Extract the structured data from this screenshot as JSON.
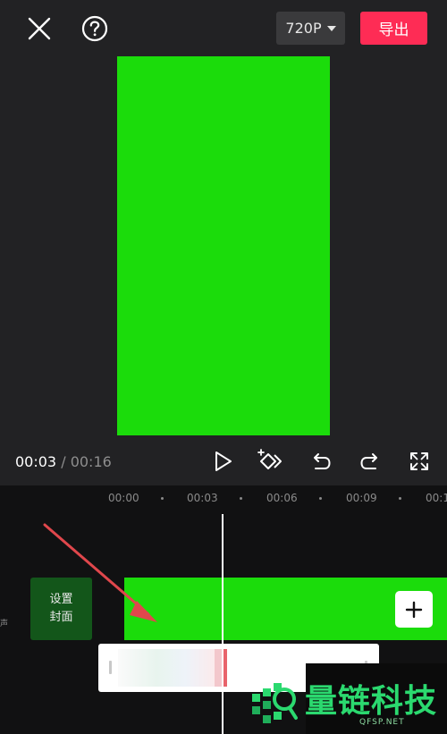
{
  "toolbar": {
    "resolution": "720P",
    "export_label": "导出"
  },
  "player": {
    "current_time": "00:03",
    "separator": "/",
    "total_time": "00:16"
  },
  "timeline": {
    "ruler": [
      "00:00",
      "00:03",
      "00:06",
      "00:09",
      "00:1"
    ],
    "side_label": "声",
    "cover_line1": "设置",
    "cover_line2": "封面"
  },
  "watermark": {
    "brand": "量链科技",
    "domain": "QFSP.NET"
  },
  "colors": {
    "accent": "#fe2c55",
    "green_screen": "#1bdc0b",
    "annotation_arrow": "#e0474c"
  }
}
